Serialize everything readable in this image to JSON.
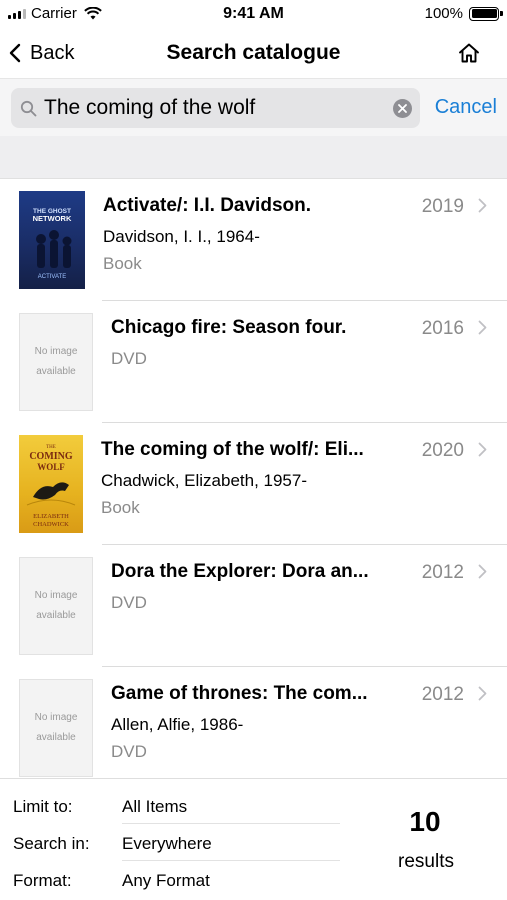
{
  "status_bar": {
    "carrier": "Carrier",
    "time": "9:41 AM",
    "battery": "100%"
  },
  "nav": {
    "back_label": "Back",
    "title": "Search catalogue",
    "home_icon": "home-icon"
  },
  "search": {
    "value": "The coming of the wolf",
    "cancel_label": "Cancel"
  },
  "results": [
    {
      "title": "Activate/: I.I. Davidson.",
      "author": "Davidson, I. I., 1964-",
      "format": "Book",
      "year": "2019",
      "cover": {
        "type": "image",
        "text_top": "THE GHOST NETWORK",
        "text_bottom": "ACTIVATE"
      }
    },
    {
      "title": "Chicago fire: Season four.",
      "author": "",
      "format": "DVD",
      "year": "2016",
      "cover": {
        "type": "placeholder",
        "text_line1": "No image",
        "text_line2": "available"
      }
    },
    {
      "title": "The coming of the wolf/: Eli...",
      "author": "Chadwick, Elizabeth, 1957-",
      "format": "Book",
      "year": "2020",
      "cover": {
        "type": "image",
        "text_top": "THE COMING OF THE WOLF",
        "text_bottom": "ELIZABETH CHADWICK"
      }
    },
    {
      "title": "Dora the Explorer: Dora an...",
      "author": "",
      "format": "DVD",
      "year": "2012",
      "cover": {
        "type": "placeholder",
        "text_line1": "No image",
        "text_line2": "available"
      }
    },
    {
      "title": "Game of thrones: The com...",
      "author": "Allen, Alfie, 1986-",
      "format": "DVD",
      "year": "2012",
      "cover": {
        "type": "placeholder",
        "text_line1": "No image",
        "text_line2": "available"
      }
    }
  ],
  "footer": {
    "filters": [
      {
        "label": "Limit to:",
        "value": "All Items"
      },
      {
        "label": "Search in:",
        "value": "Everywhere"
      },
      {
        "label": "Format:",
        "value": "Any Format"
      }
    ],
    "count": "10",
    "count_label": "results"
  },
  "colors": {
    "accent": "#1a7fd6",
    "secondary_text": "#8a8a8a",
    "search_bg": "#e4e4e6"
  }
}
